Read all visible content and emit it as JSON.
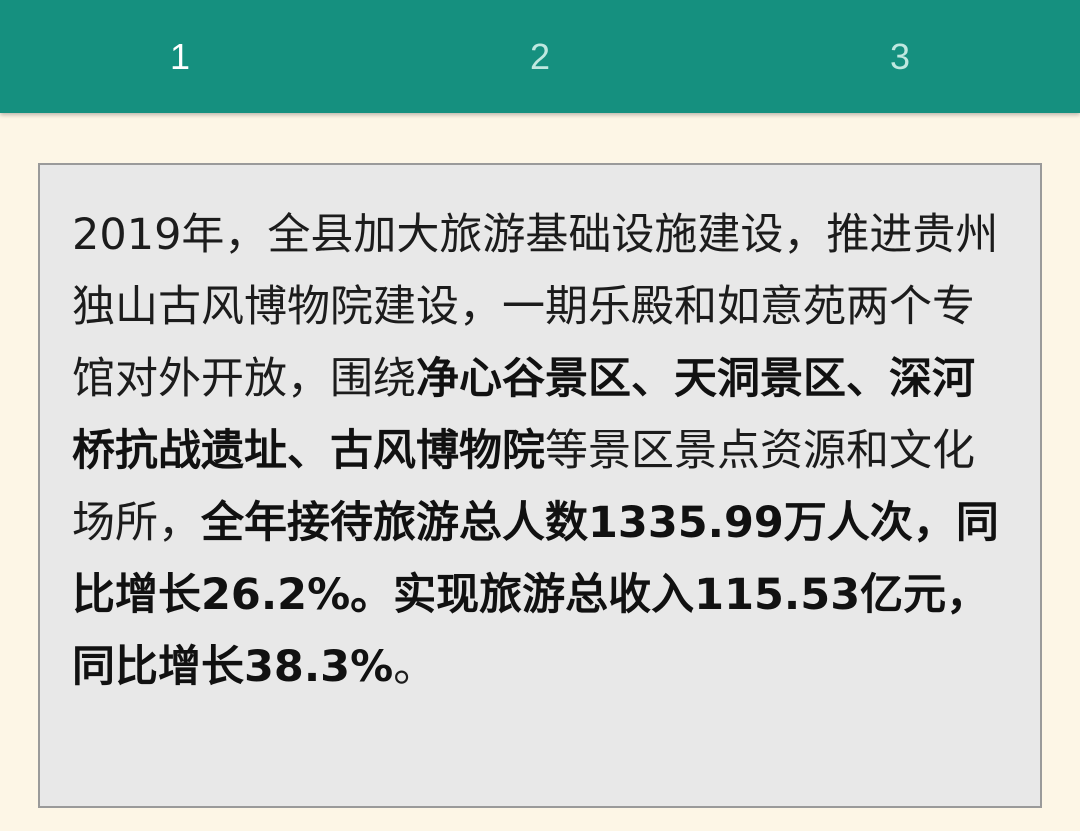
{
  "tabs": [
    {
      "label": "1"
    },
    {
      "label": "2"
    },
    {
      "label": "3"
    }
  ],
  "article": {
    "segments": [
      {
        "text": "2019年，全县加大旅游基础设施建设，推进贵州独山古风博物院建设，一期乐殿和如意苑两个专馆对外开放，围绕",
        "bold": false
      },
      {
        "text": "净心谷景区、天洞景区、深河桥抗战遗址、古风博物院",
        "bold": true
      },
      {
        "text": "等景区景点资源和文化场所，",
        "bold": false
      },
      {
        "text": "全年接待旅游总人数1335.99万人次，同比增长26.2%。实现旅游总收入115.53亿元，同比增长38.3%",
        "bold": true
      },
      {
        "text": "。",
        "bold": false
      }
    ]
  },
  "colors": {
    "tabbar": "#15907f",
    "background": "#fdf6e6",
    "card": "#e8e8e8"
  }
}
